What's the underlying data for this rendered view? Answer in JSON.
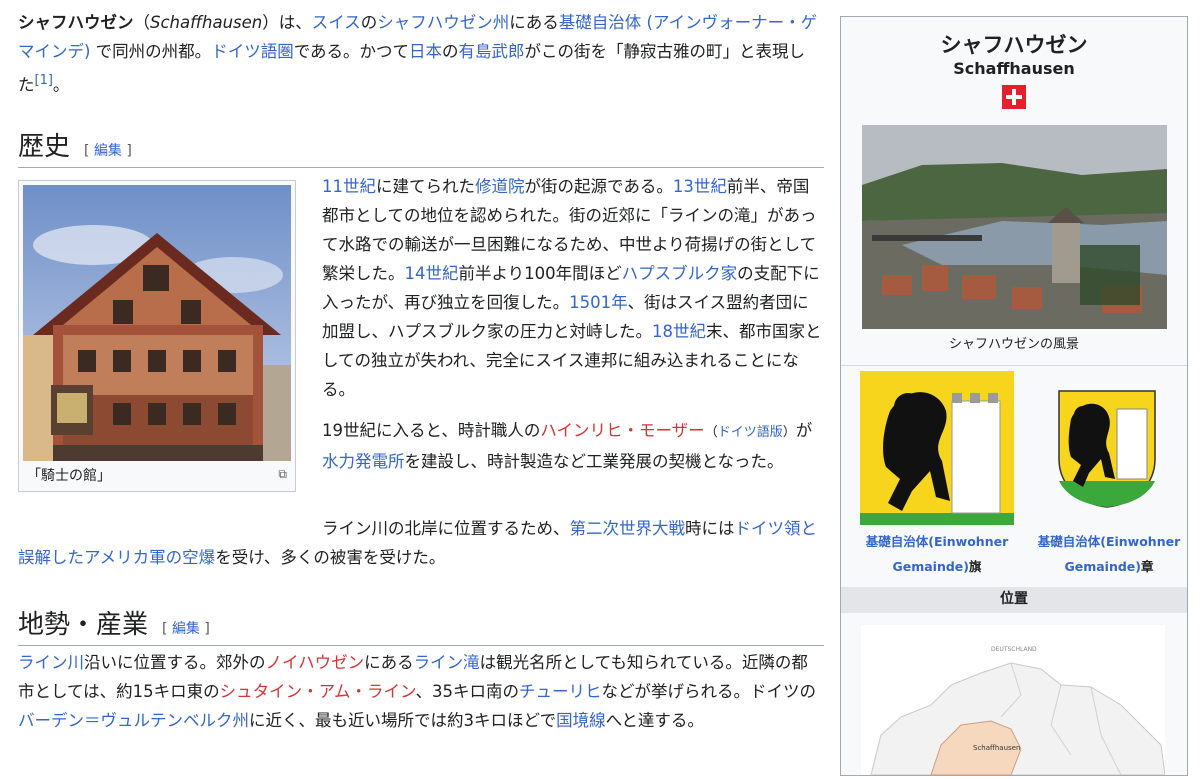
{
  "lead": {
    "title_ja": "シャフハウゼン",
    "paren_open": "（",
    "title_de": "Schaffhausen",
    "paren_close": "）",
    "t1": "は、",
    "l_suisu": "スイス",
    "t2": "の",
    "l_canton": "シャフハウゼン州",
    "t3": "にある",
    "l_kiso": "基礎自治体 (アインヴォーナー・ゲマインデ)",
    "t4": " で同州の州都。",
    "l_german": "ドイツ語圏",
    "t5": "である。かつて",
    "l_japan": "日本",
    "t6": "の",
    "l_arishima": "有島武郎",
    "t7": "がこの街を「静寂古雅の町」と表現した",
    "ref": "[1]",
    "t8": "。"
  },
  "history": {
    "heading": "歴史",
    "edit_open": "[ ",
    "edit": "編集",
    "edit_close": " ]",
    "p1": {
      "l1": "11世紀",
      "a": "に建てられた",
      "l2": "修道院",
      "b": "が街の起源である。",
      "l3": "13世紀",
      "c": "前半、帝国都市としての地位を認められた。街の近郊に「ラインの滝」があって水路での輸送が一旦困難になるため、中世より荷揚げの街として繁栄した。",
      "l4": "14世紀",
      "d": "前半より100年間ほど",
      "l5": "ハプスブルク家",
      "e": "の支配下に入ったが、再び独立を回復した。",
      "l6": "1501年",
      "f": "、街はスイス盟約者団に加盟し、ハプスブルク家の圧力と対峙した。",
      "l7": "18世紀",
      "g": "末、都市国家としての独立が失われ、完全にスイス連邦に組み込まれることになる。"
    },
    "p2": {
      "a": "19世紀に入ると、時計職人の",
      "l1": "ハインリヒ・モーザー",
      "small_open": "（",
      "small_link": "ドイツ語版",
      "small_close": "）",
      "b": "が",
      "l2": "水力発電所",
      "c": "を建設し、時計製造など工業発展の契機となった。"
    },
    "p3": {
      "a": "ライン川の北岸に位置するため、",
      "l1": "第二次世界大戦",
      "b": "時には",
      "l2": "ドイツ領と誤解したアメリカ軍の空爆",
      "c": "を受け、多くの被害を受けた。"
    },
    "thumb_caption": "「騎士の館」"
  },
  "geo": {
    "heading": "地勢・産業",
    "edit_open": "[ ",
    "edit": "編集",
    "edit_close": " ]",
    "l1": "ライン川",
    "a": "沿いに位置する。郊外の",
    "l2": "ノイハウゼン",
    "b": "にある",
    "l3": "ライン滝",
    "c": "は観光名所としても知られている。近隣の都市としては、約15キロ東の",
    "l4": "シュタイン・アム・ライン",
    "d": "、35キロ南の",
    "l5": "チューリヒ",
    "e": "などが挙げられる。ドイツの",
    "l6": "バーデン＝ヴュルテンベルク州",
    "f": "に近く、最も近い場所では約3キロほどで",
    "l7": "国境線",
    "g": "へと達する。"
  },
  "infobox": {
    "title": "シャフハウゼン",
    "subtitle": "Schaffhausen",
    "image_caption": "シャフハウゼンの風景",
    "flag_link": "基礎自治体(Einwohner Gemainde)",
    "flag_suffix": "旗",
    "coat_link": "基礎自治体(Einwohner Gemainde)",
    "coat_suffix": "章",
    "position_header": "位置",
    "map_label_country": "DEUTSCHLAND",
    "map_label_city": "Schaffhausen"
  },
  "colors": {
    "link": "#3366cc",
    "redlink": "#d73333",
    "swiss_red": "#e4202c",
    "arms_yellow": "#f7d51d",
    "arms_green": "#3aa83a"
  }
}
